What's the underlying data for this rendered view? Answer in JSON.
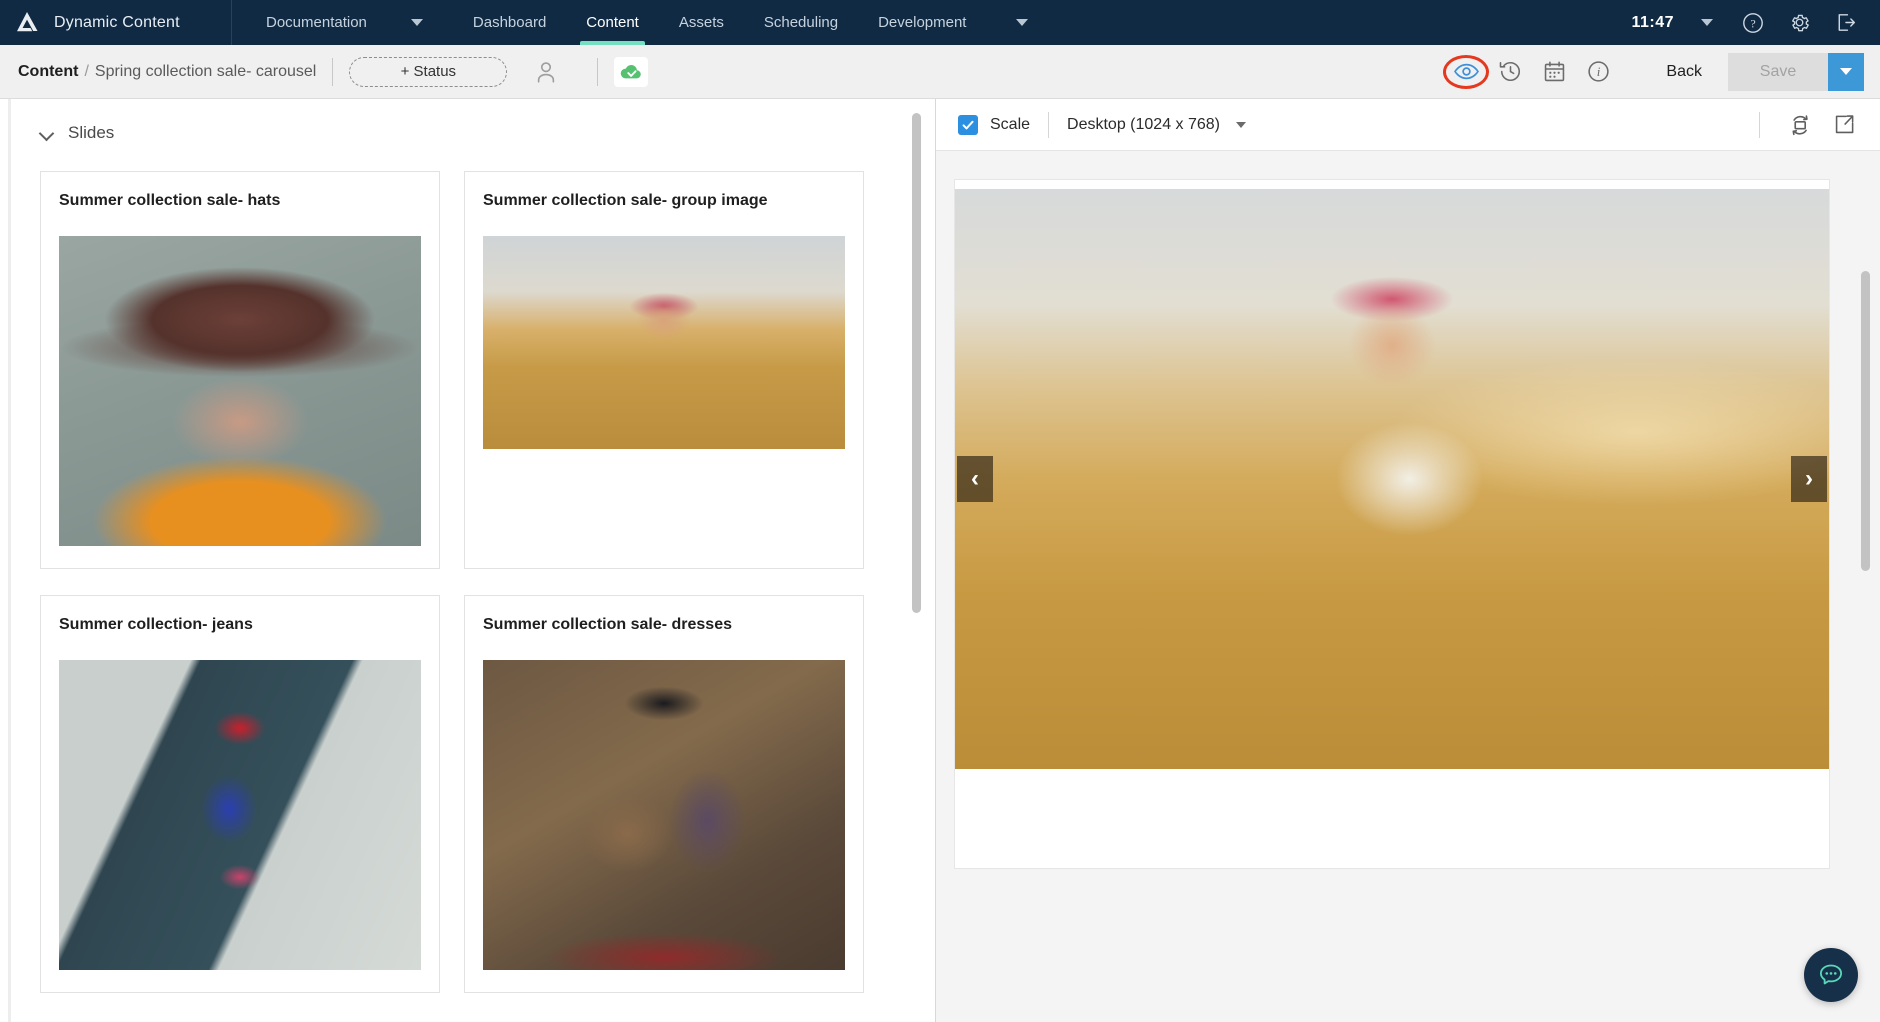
{
  "app": {
    "brand": "Dynamic Content",
    "logo_icon": "amplience-triangle-logo"
  },
  "topnav": {
    "items": [
      {
        "label": "Documentation",
        "active": false
      },
      {
        "label": "Dashboard",
        "active": false
      },
      {
        "label": "Content",
        "active": true
      },
      {
        "label": "Assets",
        "active": false
      },
      {
        "label": "Scheduling",
        "active": false
      },
      {
        "label": "Development",
        "active": false
      }
    ],
    "clock": "11:47",
    "icons": [
      "chevron-down-icon",
      "help-circle-icon",
      "gear-icon",
      "logout-icon"
    ],
    "active_underline_color": "#74e0c0",
    "background_color": "#102a43"
  },
  "subbar": {
    "breadcrumb_root": "Content",
    "breadcrumb_separator": "/",
    "breadcrumb_current": "Spring collection sale- carousel",
    "status_button": "+ Status",
    "person_icon": "user-icon",
    "cloud_icon": "cloud-upload-icon",
    "tools": [
      {
        "name": "preview-eye-icon",
        "highlighted": true,
        "highlight_color": "#e5391f"
      },
      {
        "name": "history-icon",
        "highlighted": false
      },
      {
        "name": "calendar-icon",
        "highlighted": false
      },
      {
        "name": "info-icon",
        "highlighted": false
      }
    ],
    "back_label": "Back",
    "save_label": "Save",
    "save_enabled": false,
    "save_dropdown_color": "#3d98d8"
  },
  "left_panel": {
    "section_label": "Slides",
    "section_collapse_icon": "chevron-down-icon",
    "cards": [
      {
        "title": "Summer collection sale- hats",
        "image": "woman-in-wide-brim-brown-hat-portrait",
        "shape": "portrait"
      },
      {
        "title": "Summer collection sale- group image",
        "image": "woman-in-striped-hat-in-wheat-field",
        "shape": "landscape"
      },
      {
        "title": "Summer collection- jeans",
        "image": "woman-in-blue-tracksuit-on-steps",
        "shape": "portrait"
      },
      {
        "title": "Summer collection sale- dresses",
        "image": "woman-in-black-hat-striped-dress-boho",
        "shape": "portrait"
      }
    ]
  },
  "preview": {
    "scale_label": "Scale",
    "scale_checked": true,
    "device_label": "Desktop (1024 x 768)",
    "device_caret_icon": "chevron-down-icon",
    "rotate_icon": "rotate-orientation-icon",
    "open_icon": "open-in-new-icon",
    "hero_image": "woman-in-striped-hat-in-wheat-field",
    "prev_arrow": "‹",
    "next_arrow": "›"
  },
  "chat": {
    "fab_icon": "chat-bubble-icon",
    "fab_color": "#17304a",
    "glyph_color": "#58d8b8"
  }
}
